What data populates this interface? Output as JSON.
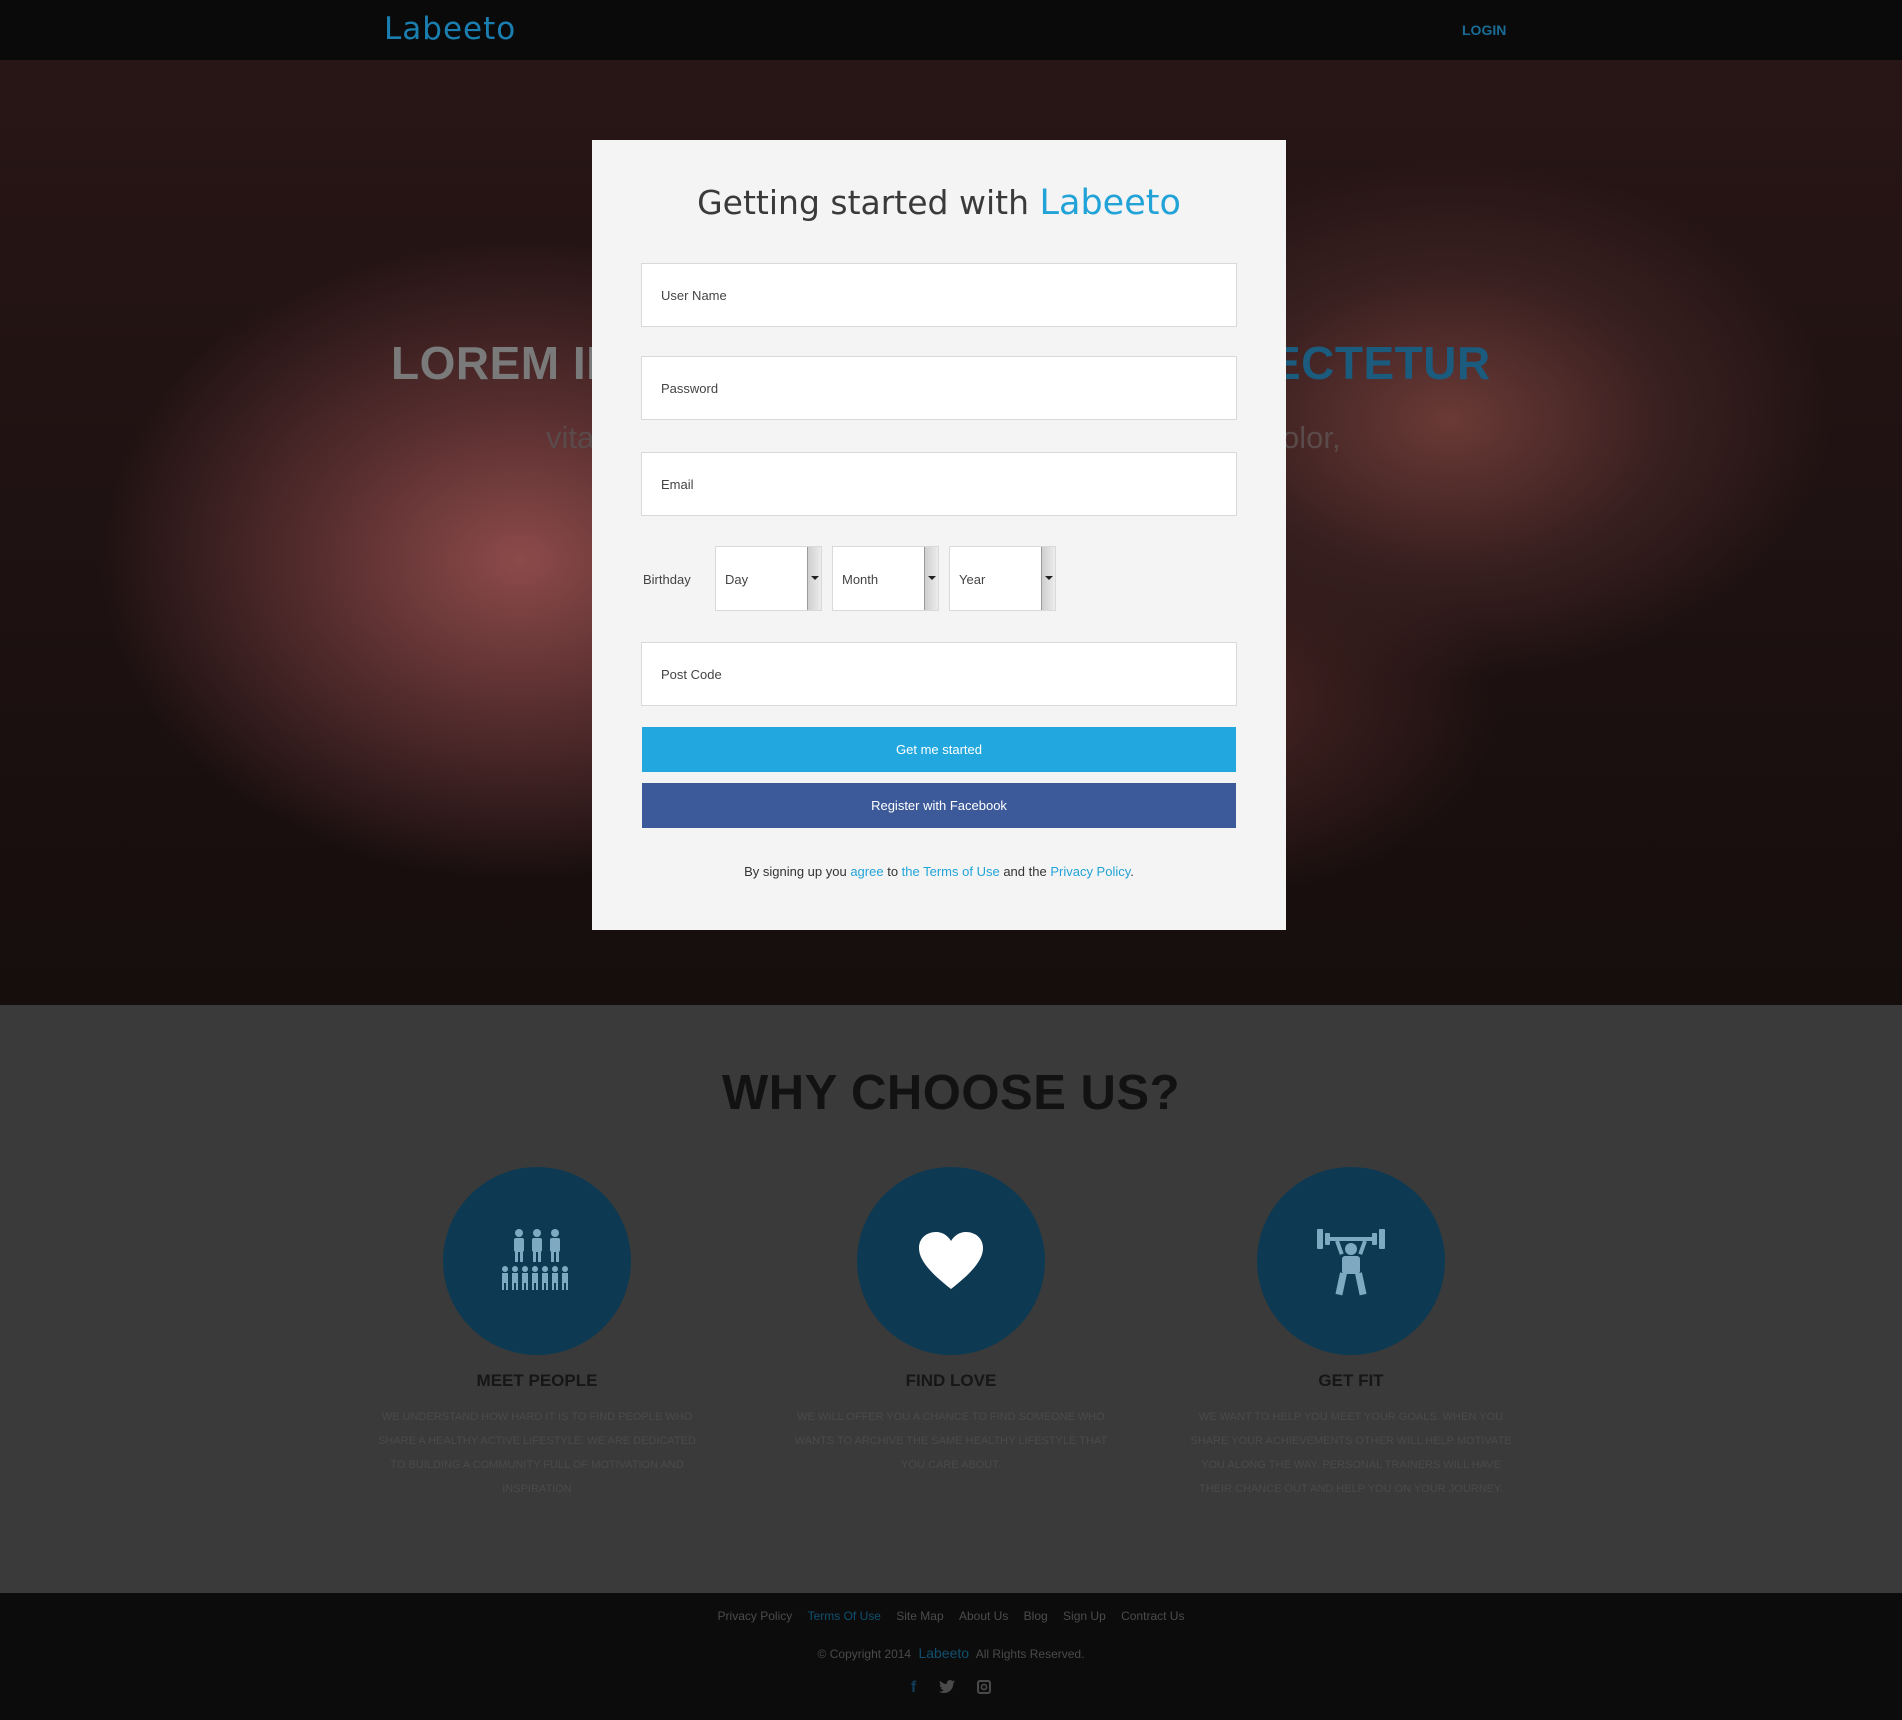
{
  "app": {
    "brand": "Labeeto",
    "nav_login": "LOGIN"
  },
  "hero": {
    "headline_left": "LOREM II",
    "headline_right": "ECTETUR",
    "sub_left": "vita",
    "sub_right": "olor,"
  },
  "modal": {
    "title_prefix": "Getting started with",
    "title_brand": "Labeeto",
    "fields": {
      "username_placeholder": "User Name",
      "password_placeholder": "Password",
      "email_placeholder": "Email",
      "postcode_placeholder": "Post Code"
    },
    "birthday": {
      "label": "Birthday",
      "day": "Day",
      "month": "Month",
      "year": "Year"
    },
    "start_button": "Get me started",
    "facebook_button": "Register with Facebook",
    "terms": {
      "prefix": "By signing up you",
      "agree": "agree",
      "to": "to",
      "terms_link": "the Terms of Use",
      "and": "and the",
      "privacy_link": "Privacy Policy",
      "period": "."
    }
  },
  "why": {
    "title": "WHY CHOOSE US?",
    "features": [
      {
        "icon": "people-icon",
        "title": "MEET PEOPLE",
        "desc": "WE UNDERSTAND HOW HARD IT IS TO FIND PEOPLE WHO SHARE A HEALTHY ACTIVE LIFESTYLE. WE ARE DEDICATED TO BUILDING A COMMUNITY FULL OF MOTIVATION AND INSPIRATION"
      },
      {
        "icon": "heart-icon",
        "title": "FIND LOVE",
        "desc": "WE WILL OFFER YOU A CHANCE TO FIND SOMEONE WHO WANTS TO ARCHIVE THE SAME HEALTHY LIFESTYLE THAT YOU CARE ABOUT."
      },
      {
        "icon": "weightlifter-icon",
        "title": "GET FIT",
        "desc": "WE WANT TO HELP YOU MEET YOUR GOALS. WHEN YOU SHARE YOUR ACHIEVEMENTS OTHER WILL HELP MOTIVATE YOU ALONG THE WAY. PERSONAL TRAINERS WILL HAVE THEIR CHANCE OUT AND HELP YOU ON YOUR JOURNEY."
      }
    ]
  },
  "footer": {
    "links": [
      "Privacy Policy",
      "Terms Of Use",
      "Site Map",
      "About Us",
      "Blog",
      "Sign Up",
      "Contract Us"
    ],
    "copyright_prefix": "© Copyright 2014",
    "copyright_brand": "Labeeto",
    "copyright_suffix": "All Rights Reserved.",
    "social": [
      "facebook-icon",
      "twitter-icon",
      "instagram-icon"
    ]
  },
  "colors": {
    "accent": "#22a8de",
    "facebook": "#3c5a9a",
    "feature_circle": "#0d3a52",
    "modal_bg": "#f4f4f4"
  }
}
